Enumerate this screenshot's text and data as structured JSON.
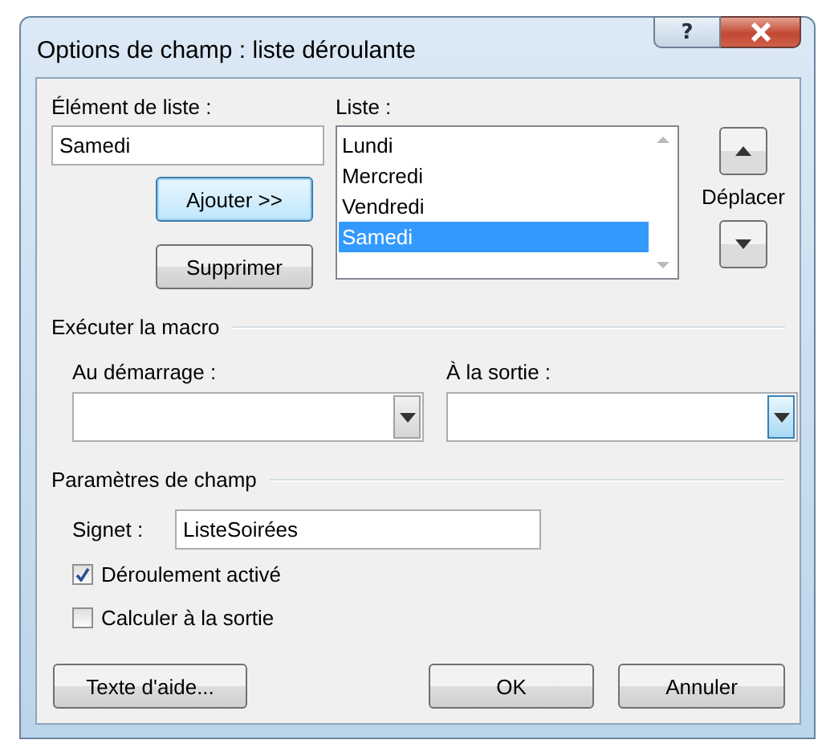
{
  "window": {
    "title": "Options de champ : liste déroulante",
    "help": "?"
  },
  "list_item": {
    "label": "Élément de liste :",
    "value": "Samedi"
  },
  "list_buttons": [
    {
      "label": "Ajouter >>",
      "default": true
    },
    {
      "label": "Supprimer",
      "default": false
    }
  ],
  "list": {
    "label": "Liste :",
    "items": [
      {
        "text": "Lundi",
        "selected": false
      },
      {
        "text": "Mercredi",
        "selected": false
      },
      {
        "text": "Vendredi",
        "selected": false
      },
      {
        "text": "Samedi",
        "selected": true
      }
    ]
  },
  "move": {
    "label": "Déplacer"
  },
  "macro": {
    "title": "Exécuter la macro",
    "combos": [
      {
        "label": "Au démarrage :",
        "hovered": false
      },
      {
        "label": "À la sortie :",
        "hovered": true
      }
    ]
  },
  "settings": {
    "title": "Paramètres de champ",
    "bookmark": {
      "label": "Signet :",
      "value": "ListeSoirées"
    },
    "options": [
      {
        "label": "Déroulement activé",
        "checked": true
      },
      {
        "label": "Calculer à la sortie",
        "checked": false
      }
    ]
  },
  "buttons": [
    "Texte d'aide...",
    "OK",
    "Annuler"
  ]
}
